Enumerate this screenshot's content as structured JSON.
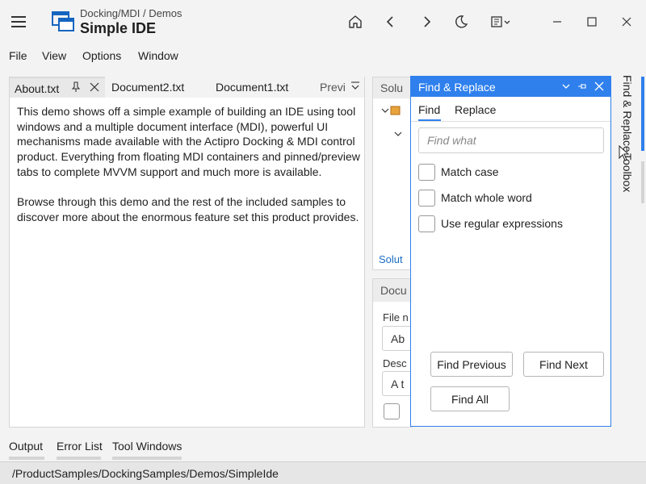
{
  "titlebar": {
    "breadcrumb": "Docking/MDI / Demos",
    "title": "Simple IDE",
    "icons": [
      "menu-icon",
      "home-icon",
      "back-icon",
      "forward-icon",
      "theme-moon-icon",
      "window-menu-icon",
      "minimize-icon",
      "maximize-icon",
      "close-icon"
    ]
  },
  "menu": {
    "items": [
      "File",
      "View",
      "Options",
      "Window"
    ]
  },
  "documents": {
    "tabs": [
      {
        "label": "About.txt",
        "active": true
      },
      {
        "label": "Document2.txt",
        "active": false
      },
      {
        "label": "Document1.txt",
        "active": false
      },
      {
        "label": "Previ",
        "active": false
      }
    ],
    "paragraphs": [
      "This demo shows off a simple example of building an IDE using tool windows and a multiple document interface (MDI), powerful UI mechanisms made available with the Actipro Docking & MDI control product. Everything from floating MDI containers and pinned/preview tabs to complete MVVM support and much more is available.",
      "Browse through this demo and the rest of the included samples to discover more about the enormous feature set this product provides."
    ]
  },
  "solution": {
    "header": "Solu",
    "link": "Solut"
  },
  "doc_props": {
    "header": "Docu",
    "label1": "File n",
    "input1": "Ab",
    "label2": "Desc",
    "input2": "A t"
  },
  "find_replace": {
    "title": "Find & Replace",
    "tabs": [
      "Find",
      "Replace"
    ],
    "placeholder": "Find what",
    "options": [
      "Match case",
      "Match whole word",
      "Use regular expressions"
    ],
    "buttons": {
      "find_previous": "Find Previous",
      "find_next": "Find Next",
      "find_all": "Find All"
    }
  },
  "side_strip": [
    "Find & Replace",
    "Toolbox"
  ],
  "bottom_tabs": [
    "Output",
    "Error List",
    "Tool Windows"
  ],
  "status": {
    "path": "/ProductSamples/DockingSamples/Demos/SimpleIde"
  },
  "colors": {
    "accent": "#2f80ed",
    "background": "#f3f3f3"
  }
}
